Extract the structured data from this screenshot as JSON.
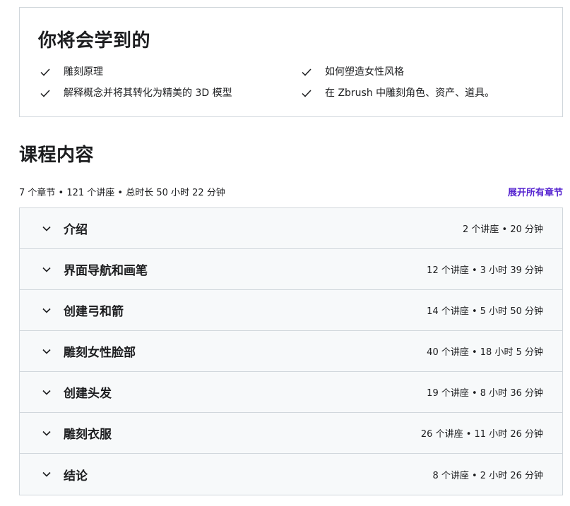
{
  "learn": {
    "title": "你将会学到的",
    "items": [
      {
        "text": "雕刻原理"
      },
      {
        "text": "如何塑造女性风格"
      },
      {
        "text": "解释概念并将其转化为精美的 3D 模型"
      },
      {
        "text": "在 Zbrush 中雕刻角色、资产、道具。"
      }
    ]
  },
  "content": {
    "heading": "课程内容",
    "summary": "7 个章节 • 121 个讲座 • 总时长 50 小时 22 分钟",
    "expand_all": "展开所有章节",
    "sections": [
      {
        "title": "介绍",
        "meta": "2 个讲座 • 20 分钟"
      },
      {
        "title": "界面导航和画笔",
        "meta": "12 个讲座 • 3 小时 39 分钟"
      },
      {
        "title": "创建弓和箭",
        "meta": "14 个讲座 • 5 小时 50 分钟"
      },
      {
        "title": "雕刻女性脸部",
        "meta": "40 个讲座 • 18 小时 5 分钟"
      },
      {
        "title": "创建头发",
        "meta": "19 个讲座 • 8 小时 36 分钟"
      },
      {
        "title": "雕刻衣服",
        "meta": "26 个讲座 • 11 小时 26 分钟"
      },
      {
        "title": "结论",
        "meta": "8 个讲座 • 2 小时 26 分钟"
      }
    ]
  },
  "colors": {
    "accent": "#5624d0",
    "border": "#d1d7dc",
    "row_bg": "#f7f9fa",
    "text": "#1c1d1f"
  },
  "icons": {
    "check": "check-icon",
    "chevron": "chevron-down-icon"
  }
}
